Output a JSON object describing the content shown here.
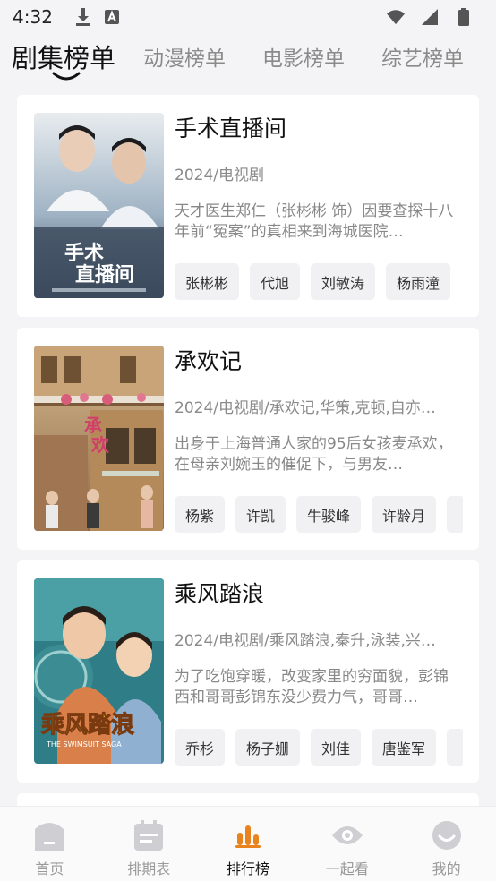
{
  "status_bar": {
    "time": "4:32",
    "icons": [
      "download-icon",
      "a-box-icon",
      "wifi-icon",
      "signal-icon",
      "battery-icon"
    ]
  },
  "tabs": [
    {
      "label": "剧集榜单",
      "active": true
    },
    {
      "label": "动漫榜单",
      "active": false
    },
    {
      "label": "电影榜单",
      "active": false
    },
    {
      "label": "综艺榜单",
      "active": false
    }
  ],
  "cards": [
    {
      "title": "手术直播间",
      "meta": "2024/电视剧",
      "description": "天才医生郑仁（张彬彬 饰）因要查探十八年前“冤案”的真相来到海城医院…",
      "tags": [
        "张彬彬",
        "代旭",
        "刘敏涛",
        "杨雨潼"
      ]
    },
    {
      "title": "承欢记",
      "meta": "2024/电视剧/承欢记,华策,克顿,自亦…",
      "description": "出身于上海普通人家的95后女孩麦承欢，在母亲刘婉玉的催促下，与男友…",
      "tags": [
        "杨紫",
        "许凯",
        "牛骏峰",
        "许龄月"
      ]
    },
    {
      "title": "乘风踏浪",
      "meta": "2024/电视剧/乘风踏浪,秦升,泳装,兴…",
      "description": "为了吃饱穿暖，改变家里的穷面貌，彭锦西和哥哥彭锦东没少费力气，哥哥…",
      "tags": [
        "乔杉",
        "杨子姗",
        "刘佳",
        "唐鉴军"
      ]
    }
  ],
  "bottom_nav": [
    {
      "label": "首页",
      "icon": "home-icon",
      "active": false
    },
    {
      "label": "排期表",
      "icon": "schedule-icon",
      "active": false
    },
    {
      "label": "排行榜",
      "icon": "ranking-icon",
      "active": true
    },
    {
      "label": "一起看",
      "icon": "eye-icon",
      "active": false
    },
    {
      "label": "我的",
      "icon": "profile-icon",
      "active": false
    }
  ],
  "colors": {
    "accent": "#e8831e",
    "background": "#f4f4f6",
    "card": "#ffffff",
    "tag_bg": "#f1f1f3"
  }
}
